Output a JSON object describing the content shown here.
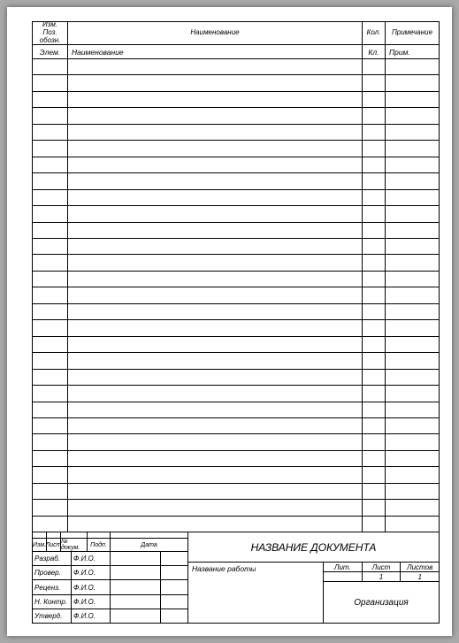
{
  "header": {
    "col_pos": "Изм. Поз. обозн.",
    "col_name": "Наименование",
    "col_qty": "Кол.",
    "col_note": "Примечание"
  },
  "subheader": {
    "elem": "Элем.",
    "name": "Наименование",
    "kl": "Кл.",
    "prim": "Прим."
  },
  "rows_count": 29,
  "titleblock": {
    "micro": {
      "izm": "Изм.",
      "list": "Лист",
      "ndoc": "№ докум.",
      "podp": "Подп.",
      "date": "Дата"
    },
    "sign_rows": [
      {
        "role": "Разраб.",
        "name": "Ф.И.О."
      },
      {
        "role": "Провер.",
        "name": "Ф.И.О."
      },
      {
        "role": "Реценз.",
        "name": "Ф.И.О."
      },
      {
        "role": "Н. Контр.",
        "name": "Ф.И.О."
      },
      {
        "role": "Утверд.",
        "name": "Ф.И.О."
      }
    ],
    "doc_title": "НАЗВАНИЕ ДОКУМЕНТА",
    "work_name": "Название работы",
    "counts": {
      "lit": "Лит.",
      "list": "Лист",
      "listov": "Листов",
      "list_val": "1",
      "listov_val": "1"
    },
    "org": "Организация"
  }
}
